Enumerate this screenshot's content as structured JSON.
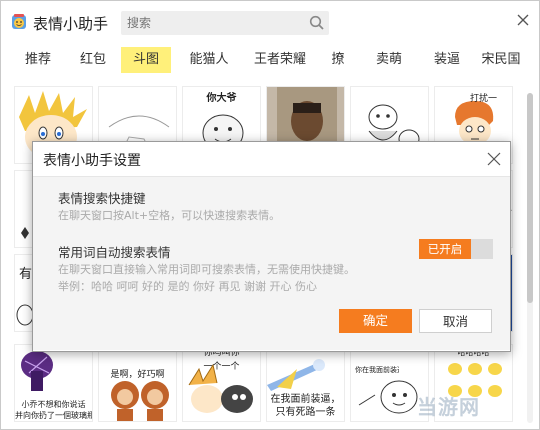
{
  "app": {
    "title": "表情小助手"
  },
  "search": {
    "placeholder": "搜索"
  },
  "tabs": [
    {
      "label": "推荐"
    },
    {
      "label": "红包"
    },
    {
      "label": "斗图",
      "active": true
    },
    {
      "label": "能猫人"
    },
    {
      "label": "王者荣耀"
    },
    {
      "label": "撩"
    },
    {
      "label": "卖萌"
    },
    {
      "label": "装逼"
    },
    {
      "label": "宋民国"
    }
  ],
  "stickers": {
    "captions": {
      "fat_face": "你大爷",
      "ask_face": "打扰一",
      "row_label": "有",
      "purple_top": "小乔不想和你说话",
      "purple_bottom": "并向你扔了一個玻璃瓶",
      "monkey": "是啊，好巧啊",
      "anime_top": "你吗叫你",
      "anime_bottom": "一个一个",
      "bubble": "在我面前装逼，只有死路一条",
      "small_text": "你在我面前装逼",
      "duck": "哈哈哈哈"
    }
  },
  "dialog": {
    "title": "表情小助手设置",
    "hotkey": {
      "heading": "表情搜索快捷键",
      "description": "在聊天窗口按Alt+空格，可以快速搜索表情。"
    },
    "auto": {
      "heading": "常用词自动搜索表情",
      "description": "在聊天窗口直接输入常用词即可搜索表情，无需使用快捷键。",
      "example": "举例：哈哈 呵呵 好的 是的 你好 再见 谢谢 开心 伤心",
      "toggle_label": "已开启"
    },
    "ok_label": "确定",
    "cancel_label": "取消"
  },
  "watermark": "当游网",
  "colors": {
    "accent": "#f57c1f",
    "active_tab": "#fff07a"
  }
}
